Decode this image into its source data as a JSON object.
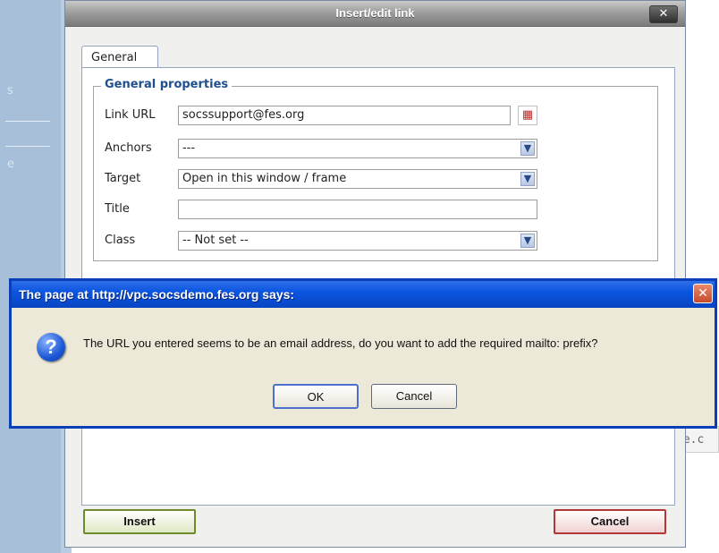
{
  "background": {
    "side_ghost_1": "s",
    "side_ghost_2": "e",
    "code_snippet": "ne.c"
  },
  "dialog": {
    "title": "Insert/edit link",
    "close_symbol": "✕",
    "tab_general": "General",
    "fieldset_legend": "General properties",
    "fields": {
      "link_url_label": "Link URL",
      "link_url_value": "socssupport@fes.org",
      "anchors_label": "Anchors",
      "anchors_value": "---",
      "target_label": "Target",
      "target_value": "Open in this window / frame",
      "title_label": "Title",
      "title_value": "",
      "class_label": "Class",
      "class_value": "-- Not set --"
    },
    "insert_button": "Insert",
    "cancel_button": "Cancel",
    "icons": {
      "close": "close-icon",
      "picker": "browse-icon",
      "dropdown": "chevron-down-icon"
    }
  },
  "alert": {
    "title": "The page at http://vpc.socsdemo.fes.org says:",
    "message": "The URL you entered seems to be an email address, do you want to add the required mailto: prefix?",
    "ok_button": "OK",
    "cancel_button": "Cancel",
    "icons": {
      "question": "question-icon",
      "close": "close-icon"
    },
    "colors": {
      "title_bar": "#0a55e0",
      "close_button": "#c64a2d"
    }
  },
  "colors": {
    "legend": "#1f4f8f",
    "insert_border": "#6f8c2d",
    "cancel_border": "#b43737"
  }
}
